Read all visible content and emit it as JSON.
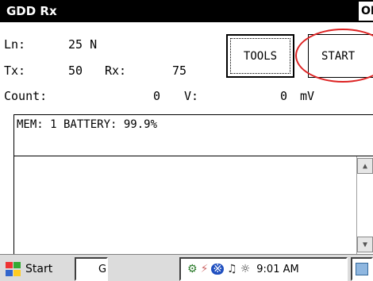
{
  "window": {
    "title": "GDD Rx",
    "ok_label": "OK"
  },
  "fields": {
    "ln_label": "Ln:",
    "ln_value": "25 N",
    "tx_label": "Tx:",
    "tx_value": "50",
    "rx_label": "Rx:",
    "rx_value": "75",
    "count_label": "Count:",
    "count_value": "0",
    "v_label": "V:",
    "v_value": "0",
    "v_unit": "mV"
  },
  "buttons": {
    "tools": "TOOLS",
    "start": "START"
  },
  "status": {
    "text": "MEM: 1 BATTERY: 99.9%"
  },
  "taskbar": {
    "start_label": "Start",
    "task_label": "G",
    "clock": "9:01 AM"
  },
  "icons": {
    "start": "windows-flag-icon",
    "scroll_up": "scroll-up-icon",
    "scroll_down": "scroll-down-icon",
    "bluetooth": "bluetooth-icon",
    "network": "network-icon",
    "battery": "battery-icon",
    "desktop": "desktop-icon"
  },
  "colors": {
    "title_bar": "#000000",
    "highlight_circle": "#dd2222",
    "taskbar": "#dcdcdc"
  }
}
